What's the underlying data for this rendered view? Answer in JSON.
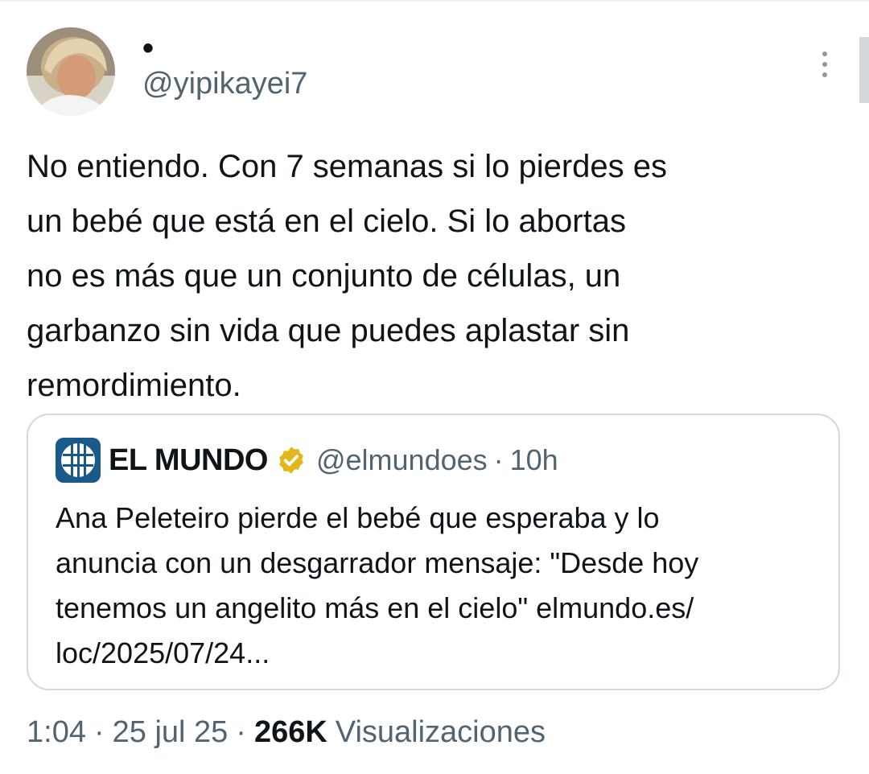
{
  "author": {
    "display_name": "•",
    "handle": "@yipikayei7"
  },
  "tweet": {
    "text": "No entiendo. Con 7 semanas si lo pierdes es\nun bebé que está en el cielo. Si lo abortas\nno es más que un conjunto de células, un\ngarbanzo sin vida que puedes aplastar sin\nremordimiento."
  },
  "quote": {
    "name": "EL MUNDO",
    "handle": "@elmundoes",
    "separator": "·",
    "time": "10h",
    "text": "Ana Peleteiro pierde el bebé que esperaba y lo\nanuncia con un desgarrador mensaje: \"Desde hoy\ntenemos un angelito más en el cielo\" elmundo.es/\nloc/2025/07/24...",
    "logo_icon": "globe-logo-icon",
    "badge_icon": "verified-gold-badge-icon",
    "logo_color": "#1a5a8a",
    "badge_color": "#e2b719"
  },
  "meta": {
    "time": "1:04",
    "separator": "·",
    "date": "25 jul 25",
    "views_count": "266K",
    "views_label": "Visualizaciones"
  },
  "icons": {
    "more": "more-vertical-icon"
  },
  "colors": {
    "text_primary": "#0f1419",
    "text_secondary": "#536471",
    "border": "#cfd9de"
  }
}
